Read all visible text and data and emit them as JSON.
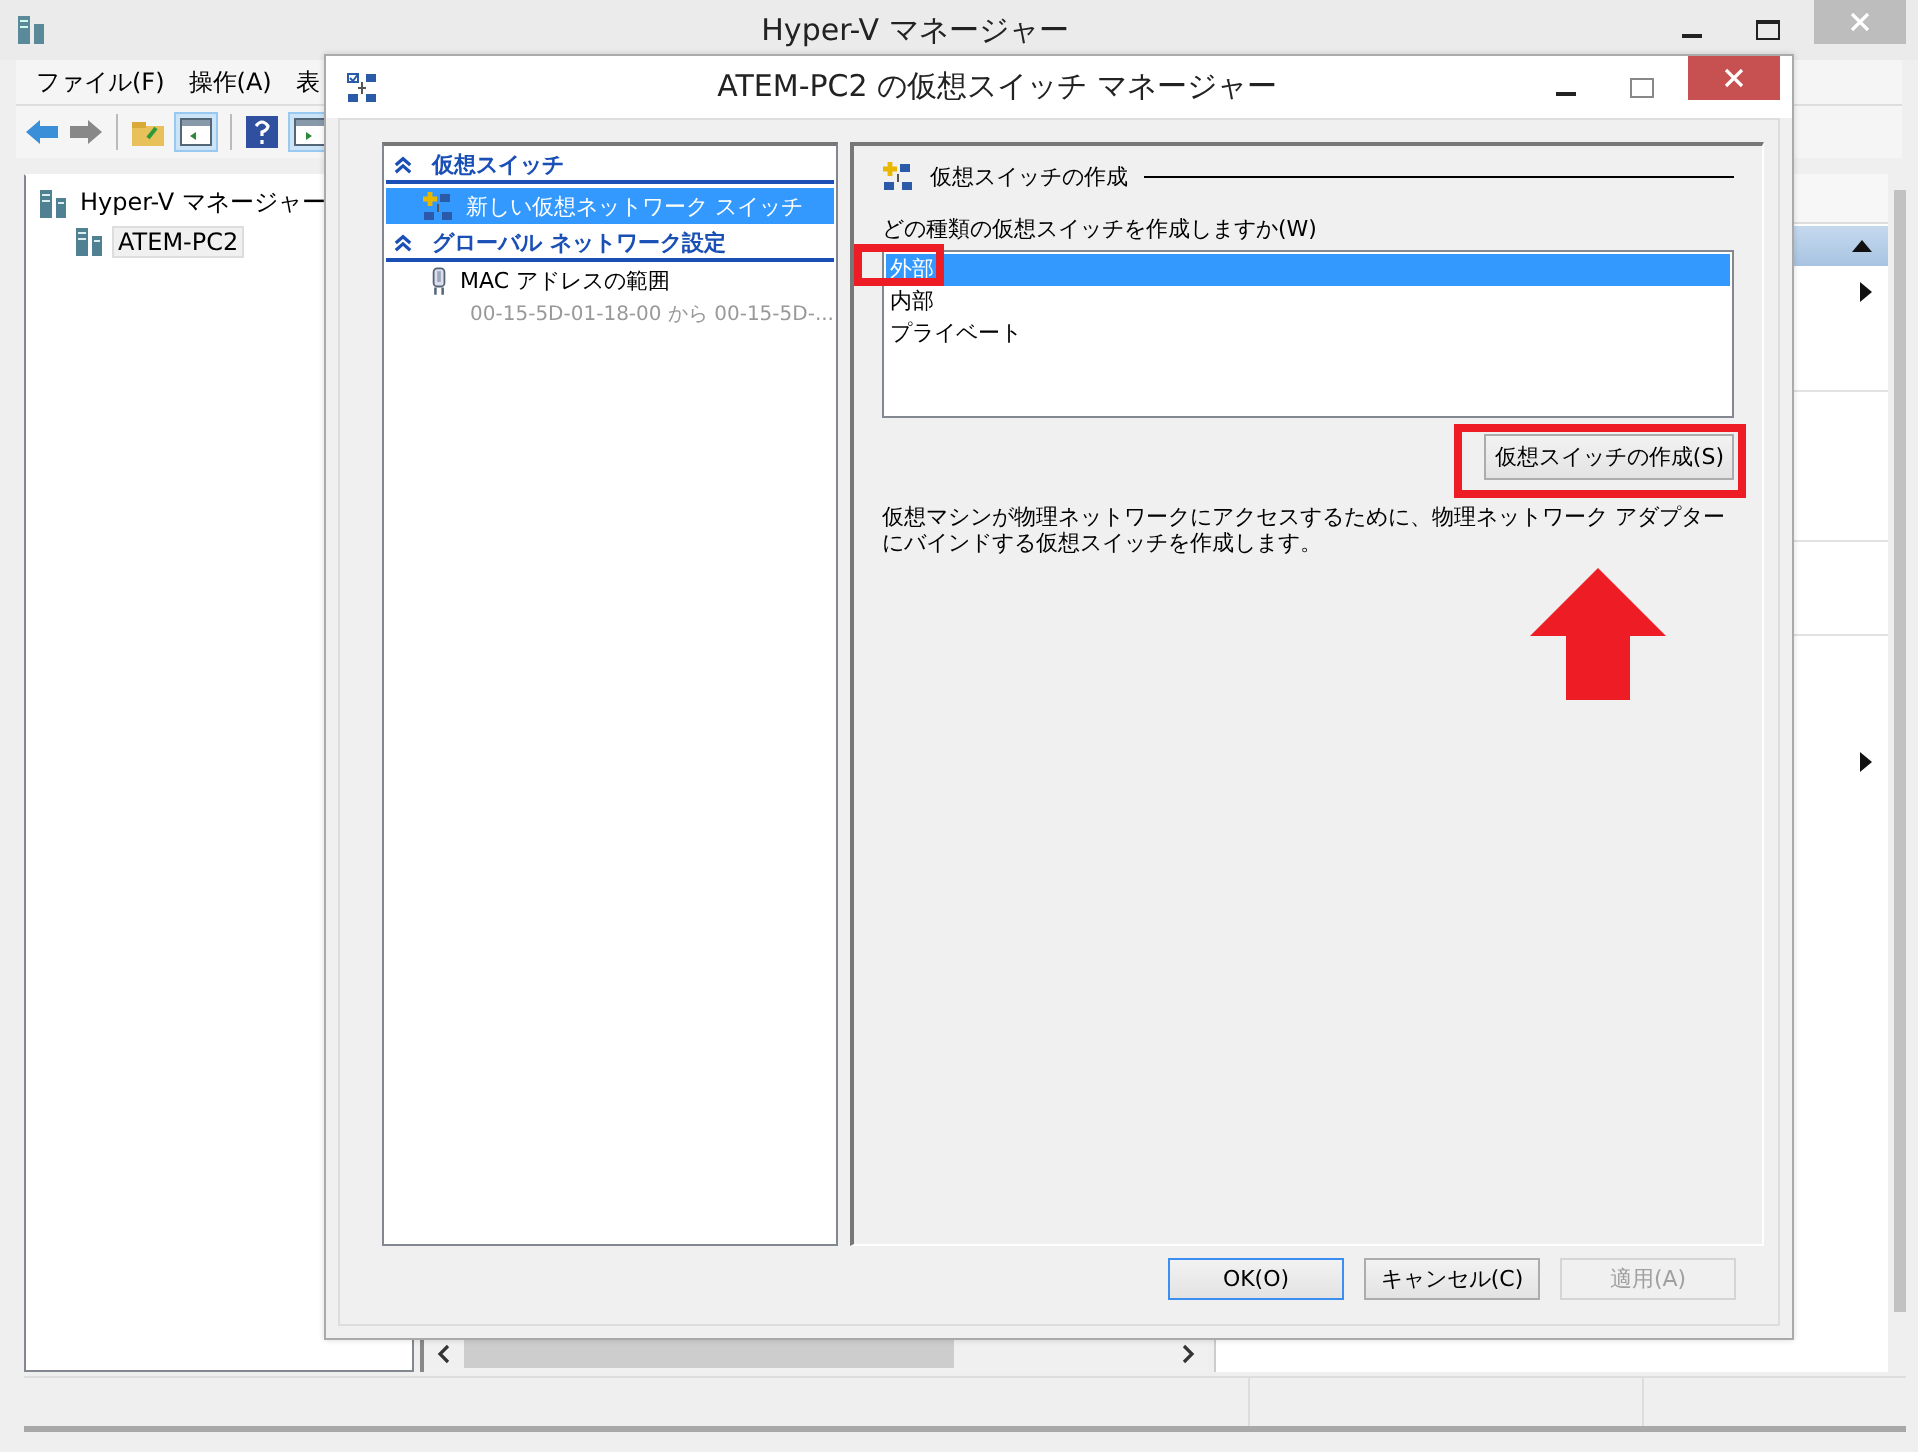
{
  "main_window": {
    "title": "Hyper-V マネージャー",
    "menu": [
      {
        "label": "ファイル(F)"
      },
      {
        "label": "操作(A)"
      },
      {
        "label": "表"
      }
    ],
    "tree": [
      {
        "label": "Hyper-V マネージャー",
        "selected": false,
        "children": [
          {
            "label": "ATEM-PC2",
            "selected": true
          }
        ]
      }
    ]
  },
  "dialog": {
    "title": "ATEM-PC2 の仮想スイッチ マネージャー",
    "nav": [
      {
        "heading": "仮想スイッチ",
        "items": [
          {
            "label": "新しい仮想ネットワーク スイッチ",
            "selected": true
          }
        ]
      },
      {
        "heading": "グローバル ネットワーク設定",
        "items": [
          {
            "label": "MAC アドレスの範囲",
            "detail": "00-15-5D-01-18-00 から 00-15-5D-...",
            "selected": false
          }
        ]
      }
    ],
    "section_title": "仮想スイッチの作成",
    "prompt": "どの種類の仮想スイッチを作成しますか(W)",
    "switch_types": [
      {
        "label": "外部",
        "selected": true
      },
      {
        "label": "内部",
        "selected": false
      },
      {
        "label": "プライベート",
        "selected": false
      }
    ],
    "create_button": "仮想スイッチの作成(S)",
    "description": "仮想マシンが物理ネットワークにアクセスするために、物理ネットワーク アダプターにバインドする仮想スイッチを作成します。",
    "buttons": [
      {
        "label": "OK(O)",
        "default": true,
        "disabled": false
      },
      {
        "label": "キャンセル(C)",
        "default": false,
        "disabled": false
      },
      {
        "label": "適用(A)",
        "default": false,
        "disabled": true
      }
    ]
  },
  "annotations": [
    {
      "kind": "box"
    },
    {
      "kind": "box"
    },
    {
      "kind": "arrow"
    }
  ]
}
